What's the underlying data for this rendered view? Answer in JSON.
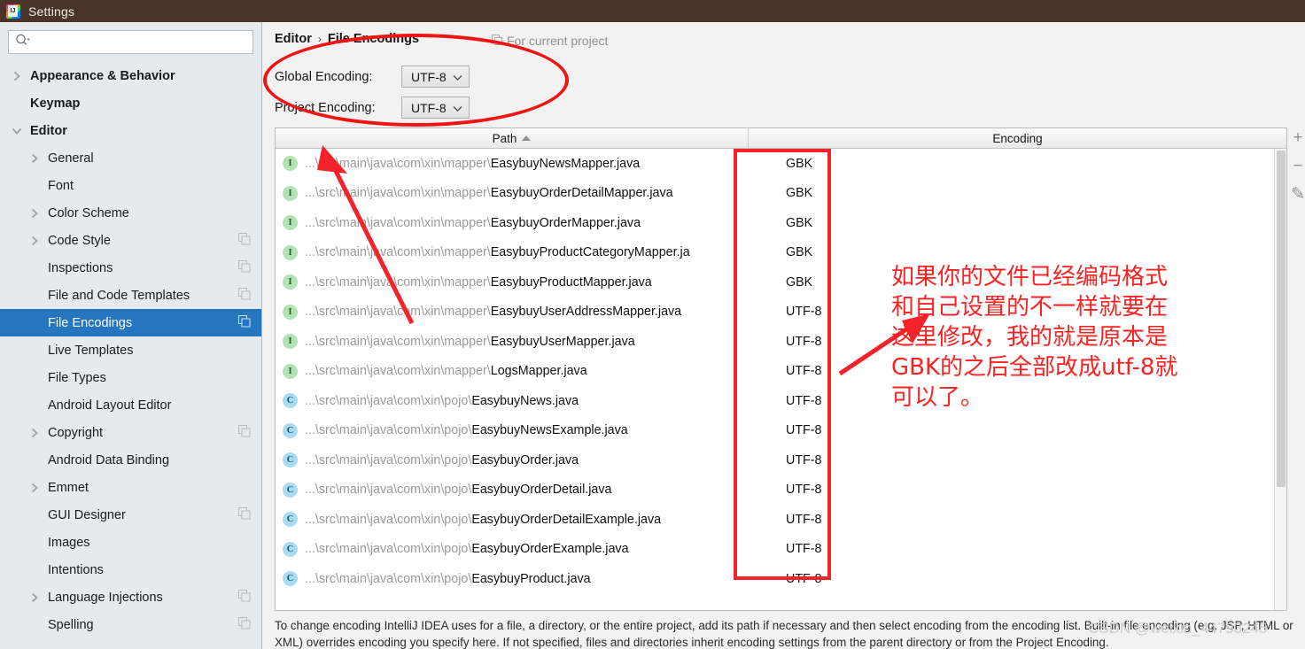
{
  "window": {
    "title": "Settings",
    "logo_icon": "intellij-idea-logo"
  },
  "sidebar": {
    "search": {
      "value": "",
      "placeholder": "",
      "icon": "search-icon"
    },
    "items": [
      {
        "label": "Appearance & Behavior",
        "indent": 0,
        "twisty": "chevron-right",
        "bold": true,
        "selected": false,
        "copy_icon": false
      },
      {
        "label": "Keymap",
        "indent": 0,
        "twisty": "none",
        "bold": true,
        "selected": false,
        "copy_icon": false
      },
      {
        "label": "Editor",
        "indent": 0,
        "twisty": "chevron-down",
        "bold": true,
        "selected": false,
        "copy_icon": false
      },
      {
        "label": "General",
        "indent": 1,
        "twisty": "chevron-right",
        "bold": false,
        "selected": false,
        "copy_icon": false
      },
      {
        "label": "Font",
        "indent": 1,
        "twisty": "none",
        "bold": false,
        "selected": false,
        "copy_icon": false
      },
      {
        "label": "Color Scheme",
        "indent": 1,
        "twisty": "chevron-right",
        "bold": false,
        "selected": false,
        "copy_icon": false
      },
      {
        "label": "Code Style",
        "indent": 1,
        "twisty": "chevron-right",
        "bold": false,
        "selected": false,
        "copy_icon": true
      },
      {
        "label": "Inspections",
        "indent": 1,
        "twisty": "none",
        "bold": false,
        "selected": false,
        "copy_icon": true
      },
      {
        "label": "File and Code Templates",
        "indent": 1,
        "twisty": "none",
        "bold": false,
        "selected": false,
        "copy_icon": true
      },
      {
        "label": "File Encodings",
        "indent": 1,
        "twisty": "none",
        "bold": false,
        "selected": true,
        "copy_icon": true
      },
      {
        "label": "Live Templates",
        "indent": 1,
        "twisty": "none",
        "bold": false,
        "selected": false,
        "copy_icon": false
      },
      {
        "label": "File Types",
        "indent": 1,
        "twisty": "none",
        "bold": false,
        "selected": false,
        "copy_icon": false
      },
      {
        "label": "Android Layout Editor",
        "indent": 1,
        "twisty": "none",
        "bold": false,
        "selected": false,
        "copy_icon": false
      },
      {
        "label": "Copyright",
        "indent": 1,
        "twisty": "chevron-right",
        "bold": false,
        "selected": false,
        "copy_icon": true
      },
      {
        "label": "Android Data Binding",
        "indent": 1,
        "twisty": "none",
        "bold": false,
        "selected": false,
        "copy_icon": false
      },
      {
        "label": "Emmet",
        "indent": 1,
        "twisty": "chevron-right",
        "bold": false,
        "selected": false,
        "copy_icon": false
      },
      {
        "label": "GUI Designer",
        "indent": 1,
        "twisty": "none",
        "bold": false,
        "selected": false,
        "copy_icon": true
      },
      {
        "label": "Images",
        "indent": 1,
        "twisty": "none",
        "bold": false,
        "selected": false,
        "copy_icon": false
      },
      {
        "label": "Intentions",
        "indent": 1,
        "twisty": "none",
        "bold": false,
        "selected": false,
        "copy_icon": false
      },
      {
        "label": "Language Injections",
        "indent": 1,
        "twisty": "chevron-right",
        "bold": false,
        "selected": false,
        "copy_icon": true
      },
      {
        "label": "Spelling",
        "indent": 1,
        "twisty": "none",
        "bold": false,
        "selected": false,
        "copy_icon": true
      }
    ]
  },
  "main": {
    "breadcrumb": {
      "parent": "Editor",
      "separator": "›",
      "current": "File Encodings"
    },
    "for_current_project": {
      "label": "For current project",
      "icon": "copy-icon"
    },
    "global_encoding": {
      "label": "Global Encoding:",
      "value": "UTF-8"
    },
    "project_encoding": {
      "label": "Project Encoding:",
      "value": "UTF-8"
    },
    "table": {
      "columns": [
        "Path",
        "Encoding"
      ],
      "sort_column": "Path",
      "sort_direction": "ascending",
      "rows": [
        {
          "icon": "interface-icon",
          "kind": "I",
          "dir": "...\\src\\main\\java\\com\\xin\\mapper\\",
          "file": "EasybuyNewsMapper.java",
          "encoding": "GBK"
        },
        {
          "icon": "interface-icon",
          "kind": "I",
          "dir": "...\\src\\main\\java\\com\\xin\\mapper\\",
          "file": "EasybuyOrderDetailMapper.java",
          "encoding": "GBK"
        },
        {
          "icon": "interface-icon",
          "kind": "I",
          "dir": "...\\src\\main\\java\\com\\xin\\mapper\\",
          "file": "EasybuyOrderMapper.java",
          "encoding": "GBK"
        },
        {
          "icon": "interface-icon",
          "kind": "I",
          "dir": "...\\src\\main\\java\\com\\xin\\mapper\\",
          "file": "EasybuyProductCategoryMapper.ja",
          "encoding": "GBK"
        },
        {
          "icon": "interface-icon",
          "kind": "I",
          "dir": "...\\src\\main\\java\\com\\xin\\mapper\\",
          "file": "EasybuyProductMapper.java",
          "encoding": "GBK"
        },
        {
          "icon": "interface-icon",
          "kind": "I",
          "dir": "...\\src\\main\\java\\com\\xin\\mapper\\",
          "file": "EasybuyUserAddressMapper.java",
          "encoding": "UTF-8"
        },
        {
          "icon": "interface-icon",
          "kind": "I",
          "dir": "...\\src\\main\\java\\com\\xin\\mapper\\",
          "file": "EasybuyUserMapper.java",
          "encoding": "UTF-8"
        },
        {
          "icon": "interface-icon",
          "kind": "I",
          "dir": "...\\src\\main\\java\\com\\xin\\mapper\\",
          "file": "LogsMapper.java",
          "encoding": "UTF-8"
        },
        {
          "icon": "class-icon",
          "kind": "C",
          "dir": "...\\src\\main\\java\\com\\xin\\pojo\\",
          "file": "EasybuyNews.java",
          "encoding": "UTF-8"
        },
        {
          "icon": "class-icon",
          "kind": "C",
          "dir": "...\\src\\main\\java\\com\\xin\\pojo\\",
          "file": "EasybuyNewsExample.java",
          "encoding": "UTF-8"
        },
        {
          "icon": "class-icon",
          "kind": "C",
          "dir": "...\\src\\main\\java\\com\\xin\\pojo\\",
          "file": "EasybuyOrder.java",
          "encoding": "UTF-8"
        },
        {
          "icon": "class-icon",
          "kind": "C",
          "dir": "...\\src\\main\\java\\com\\xin\\pojo\\",
          "file": "EasybuyOrderDetail.java",
          "encoding": "UTF-8"
        },
        {
          "icon": "class-icon",
          "kind": "C",
          "dir": "...\\src\\main\\java\\com\\xin\\pojo\\",
          "file": "EasybuyOrderDetailExample.java",
          "encoding": "UTF-8"
        },
        {
          "icon": "class-icon",
          "kind": "C",
          "dir": "...\\src\\main\\java\\com\\xin\\pojo\\",
          "file": "EasybuyOrderExample.java",
          "encoding": "UTF-8"
        },
        {
          "icon": "class-icon",
          "kind": "C",
          "dir": "...\\src\\main\\java\\com\\xin\\pojo\\",
          "file": "EasybuyProduct.java",
          "encoding": "UTF-8"
        }
      ]
    },
    "tools": [
      {
        "name": "add-button",
        "glyph": "+"
      },
      {
        "name": "remove-button",
        "glyph": "−"
      },
      {
        "name": "edit-button",
        "glyph": "✎"
      }
    ],
    "description": "To change encoding IntelliJ IDEA uses for a file, a directory, or the entire project, add its path if necessary and then select encoding from the encoding list. Built-in file encoding (e.g. JSP, HTML or XML) overrides encoding you specify here. If not specified, files and directories inherit encoding settings from the parent directory or from the Project Encoding."
  },
  "annotations": {
    "note_text": "如果你的文件已经编码格式\n和自己设置的不一样就要在\n这里修改，我的就是原本是\nGBK的之后全部改成utf-8就\n可以了。",
    "note_color": "#fc2222",
    "highlight_color": "#f4222a",
    "ellipse_color": "#f01414"
  },
  "watermark": "CSDN @weixin_44793245"
}
